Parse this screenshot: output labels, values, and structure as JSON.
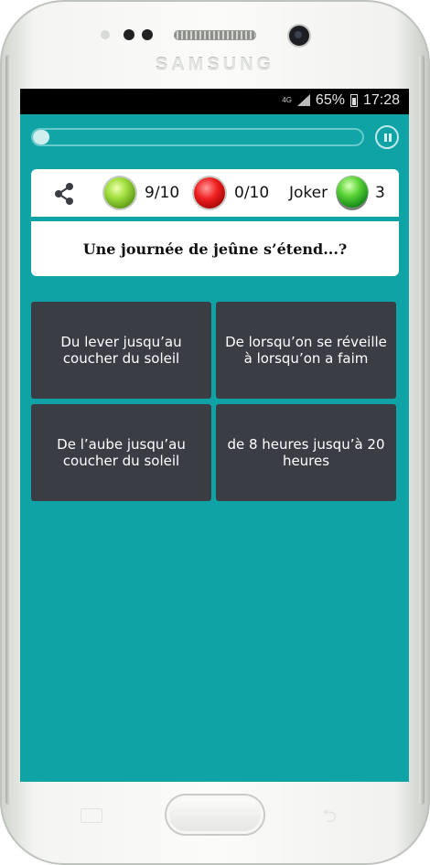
{
  "device": {
    "brand": "SAMSUNG"
  },
  "status_bar": {
    "network": "4G",
    "battery": "65%",
    "time": "17:28"
  },
  "quiz": {
    "progress_percent": 5,
    "correct": "9/10",
    "wrong": "0/10",
    "joker_label": "Joker",
    "joker_count": "3",
    "question": "Une journée de jeûne s’étend...?",
    "answers": [
      "Du lever jusqu’au coucher du soleil",
      "De lorsqu’on se réveille à lorsqu’on a faim",
      "De l’aube jusqu’au coucher du soleil",
      "de 8 heures jusqu’à 20 heures"
    ]
  },
  "colors": {
    "background": "#0fa3a6",
    "answer_tile": "#3a3d44",
    "correct_lamp": "green",
    "wrong_lamp": "red"
  }
}
